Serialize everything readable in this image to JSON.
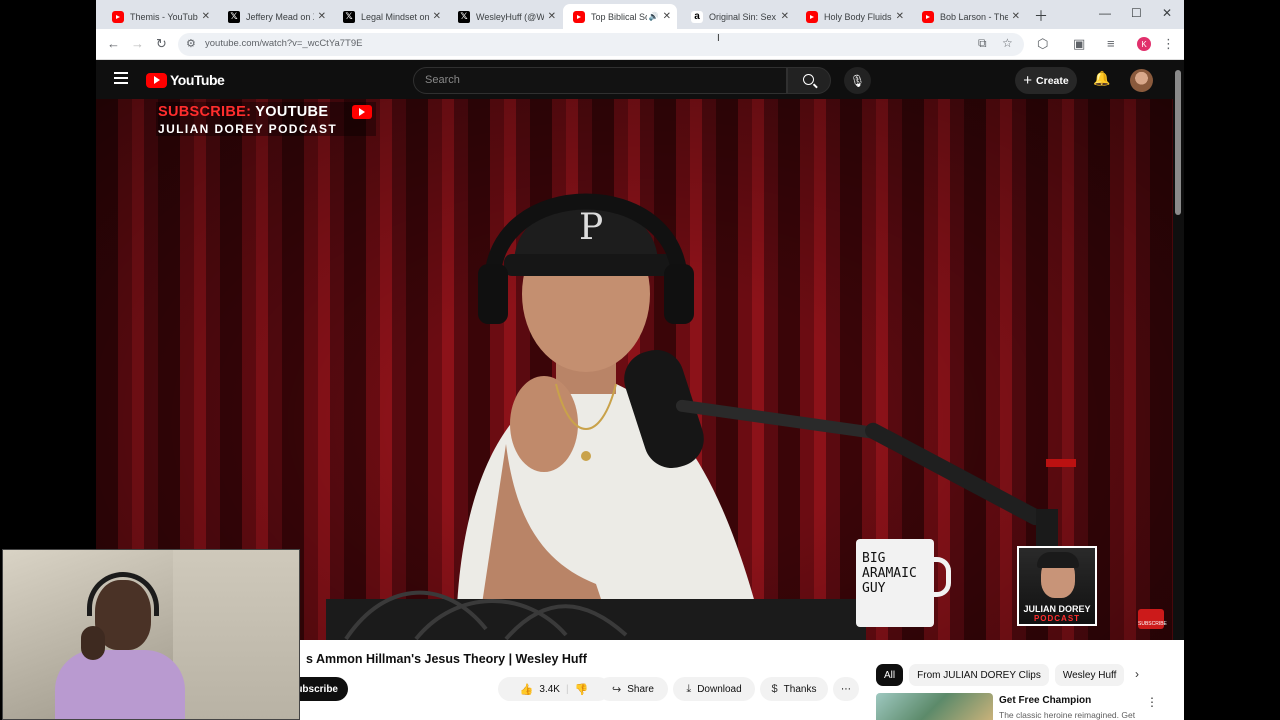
{
  "browser": {
    "tabs": [
      {
        "label": "Themis - YouTube",
        "favicon": "youtube",
        "active": false
      },
      {
        "label": "Jeffery Mead on X",
        "favicon": "x",
        "active": false
      },
      {
        "label": "Legal Mindset on X",
        "favicon": "x",
        "active": false
      },
      {
        "label": "WesleyHuff (@W",
        "favicon": "x",
        "active": false
      },
      {
        "label": "Top Biblical Sc",
        "favicon": "youtube",
        "active": true
      },
      {
        "label": "Original Sin: Sex",
        "favicon": "amazon",
        "active": false
      },
      {
        "label": "Holy Body Fluids",
        "favicon": "youtube",
        "active": false
      },
      {
        "label": "Bob Larson - The",
        "favicon": "youtube",
        "active": false
      }
    ],
    "new_tab_icon": "plus-icon",
    "url": "youtube.com/watch?v=_wcCtYa7T9E",
    "profile_initial": "K"
  },
  "youtube": {
    "logo_text": "YouTube",
    "search_placeholder": "Search",
    "create_label": "Create",
    "video_overlay": {
      "banner_line1_red": "SUBSCRIBE:",
      "banner_line1_white": " YOUTUBE",
      "banner_line2": "JULIAN DOREY PODCAST",
      "mug_text": "BIG ARAMAIC GUY",
      "end_card_name": "JULIAN DOREY",
      "end_card_sub": "PODCAST",
      "watermark_label": "SUBSCRIBE"
    },
    "video_title": "s Ammon Hillman's Jesus Theory | Wesley Huff",
    "subscribe_label": "ubscribe",
    "likes": "3.4K",
    "share_label": "Share",
    "download_label": "Download",
    "thanks_label": "Thanks",
    "more_label": "⋯",
    "chips": [
      "All",
      "From JULIAN DOREY Clips",
      "Wesley Huff"
    ],
    "recommendation": {
      "title": "Get Free Champion",
      "description": "The classic heroine reimagined. Get"
    }
  }
}
